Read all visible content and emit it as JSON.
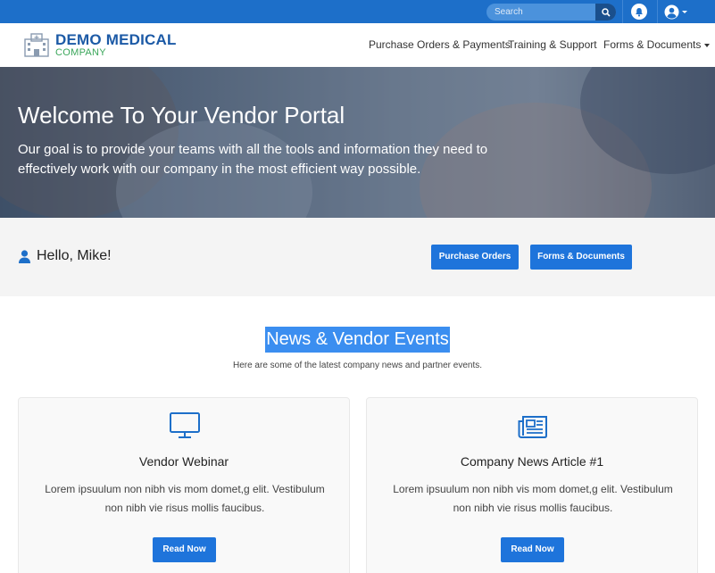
{
  "topbar": {
    "search_placeholder": "Search",
    "search_icon": "search-icon",
    "notification_icon": "bell-icon",
    "user_icon": "user-circle-icon",
    "accent": "#1d6fc9"
  },
  "brand": {
    "line1": "DEMO MEDICAL",
    "line2": "COMPANY",
    "icon": "hospital-building-icon"
  },
  "nav": {
    "items": [
      {
        "label": "Purchase Orders & Payments"
      },
      {
        "label": "Training & Support"
      },
      {
        "label": "Forms & Documents",
        "has_dropdown": true
      }
    ]
  },
  "hero": {
    "title": "Welcome To Your Vendor Portal",
    "description": "Our goal is to provide your teams with all the tools and information they need to effectively work with our company in the most efficient way possible."
  },
  "greeting": {
    "icon": "user-icon",
    "text": "Hello, Mike!",
    "buttons": [
      {
        "label": "Purchase Orders"
      },
      {
        "label": "Forms & Documents"
      }
    ]
  },
  "news": {
    "title": "News & Vendor Events",
    "subtitle": "Here are some of the latest company news and partner events.",
    "cards": [
      {
        "icon": "monitor-icon",
        "title": "Vendor Webinar",
        "text": "Lorem ipsuulum non nibh vis mom domet,g elit. Vestibulum non nibh vie risus mollis faucibus.",
        "button": "Read Now"
      },
      {
        "icon": "newspaper-icon",
        "title": "Company News Article #1",
        "text": "Lorem ipsuulum non nibh vis mom domet,g elit. Vestibulum non nibh vie risus mollis faucibus.",
        "button": "Read Now"
      }
    ]
  },
  "colors": {
    "primary_button": "#1e74db",
    "highlight": "#3b8ef0",
    "brand_blue": "#1c5aa6",
    "brand_green": "#3aa65a"
  }
}
